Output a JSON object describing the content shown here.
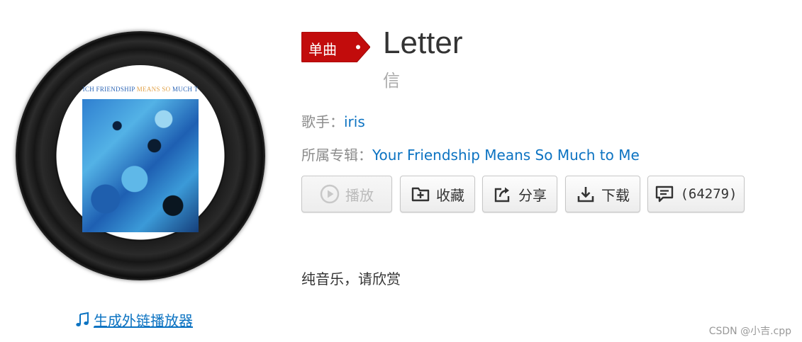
{
  "cover": {
    "title_part1": "ICH FRIENDSHIP ",
    "title_part2": "MEANS SO ",
    "title_part3": "MUCH T"
  },
  "external_player_link": "生成外链播放器",
  "badge_label": "单曲",
  "song": {
    "title": "Letter",
    "subtitle": "信"
  },
  "artist": {
    "label": "歌手：",
    "name": "iris"
  },
  "album": {
    "label": "所属专辑：",
    "name": "Your Friendship Means So Much to Me"
  },
  "buttons": {
    "play": "播放",
    "collect": "收藏",
    "share": "分享",
    "download": "下载",
    "comment_count": "(64279)"
  },
  "description": "纯音乐，请欣赏",
  "watermark": "CSDN @小吉.cpp",
  "colors": {
    "link": "#0c73c2",
    "badge": "#c20c0c",
    "meta_label": "#8c8c8c"
  },
  "icons": {
    "play": "play-circle-icon",
    "collect": "folder-add-icon",
    "share": "share-icon",
    "download": "download-icon",
    "comment": "comment-icon",
    "music_note": "music-note-icon"
  }
}
